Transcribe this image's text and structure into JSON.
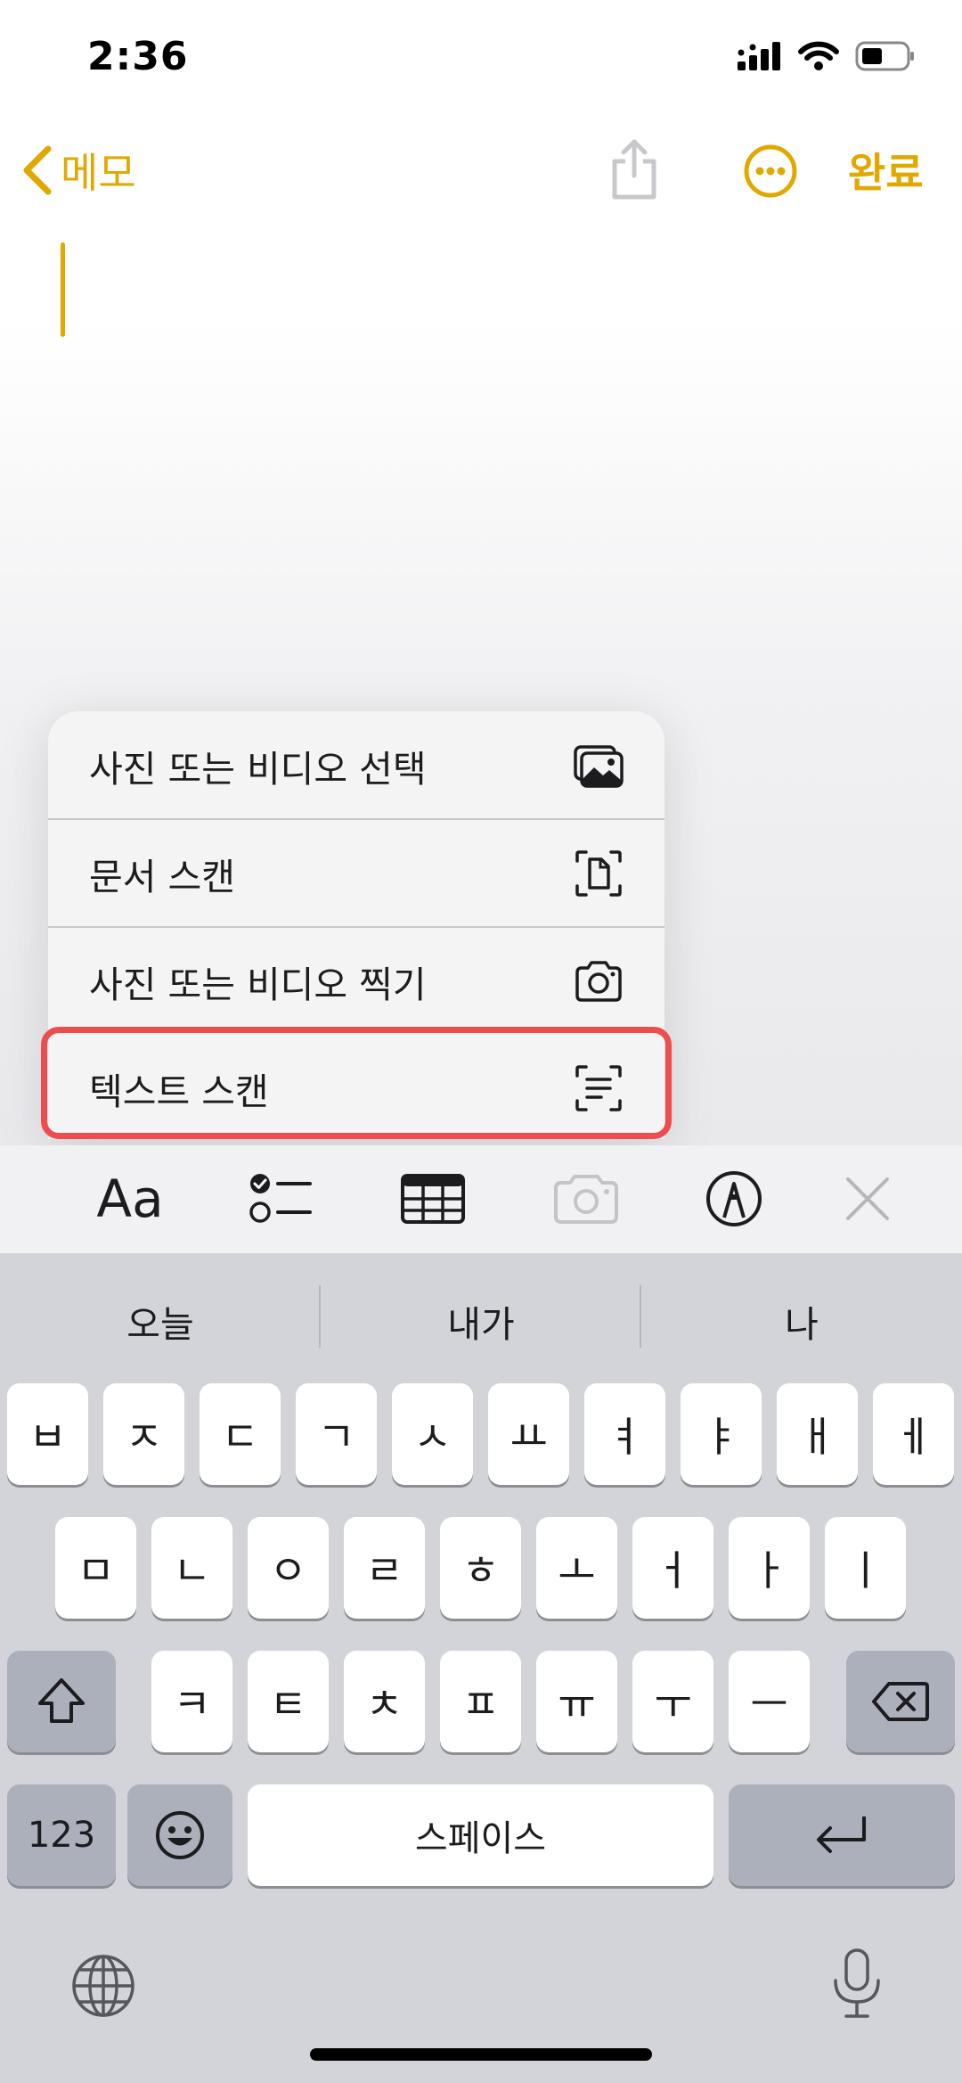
{
  "status_bar": {
    "time": "2:36"
  },
  "nav": {
    "back_label": "메모",
    "done_label": "완료"
  },
  "menu": {
    "items": [
      {
        "label": "사진 또는 비디오 선택",
        "icon": "photo-library-icon"
      },
      {
        "label": "문서 스캔",
        "icon": "document-scan-icon"
      },
      {
        "label": "사진 또는 비디오 찍기",
        "icon": "camera-icon"
      },
      {
        "label": "텍스트 스캔",
        "icon": "text-scan-icon"
      }
    ],
    "highlight_color": "#ee4d4f"
  },
  "format_toolbar": {
    "text_style_label": "Aa",
    "icons": [
      "checklist-icon",
      "table-icon",
      "camera-icon",
      "markup-icon",
      "close-icon"
    ]
  },
  "keyboard": {
    "suggestions": [
      "오늘",
      "내가",
      "나"
    ],
    "row1": [
      "ㅂ",
      "ㅈ",
      "ㄷ",
      "ㄱ",
      "ㅅ",
      "ㅛ",
      "ㅕ",
      "ㅑ",
      "ㅐ",
      "ㅔ"
    ],
    "row2": [
      "ㅁ",
      "ㄴ",
      "ㅇ",
      "ㄹ",
      "ㅎ",
      "ㅗ",
      "ㅓ",
      "ㅏ",
      "ㅣ"
    ],
    "row3": [
      "ㅋ",
      "ㅌ",
      "ㅊ",
      "ㅍ",
      "ㅠ",
      "ㅜ",
      "ㅡ"
    ],
    "numbers_label": "123",
    "space_label": "스페이스"
  },
  "colors": {
    "accent": "#e0a800",
    "keyboard_bg": "#d2d4da"
  }
}
